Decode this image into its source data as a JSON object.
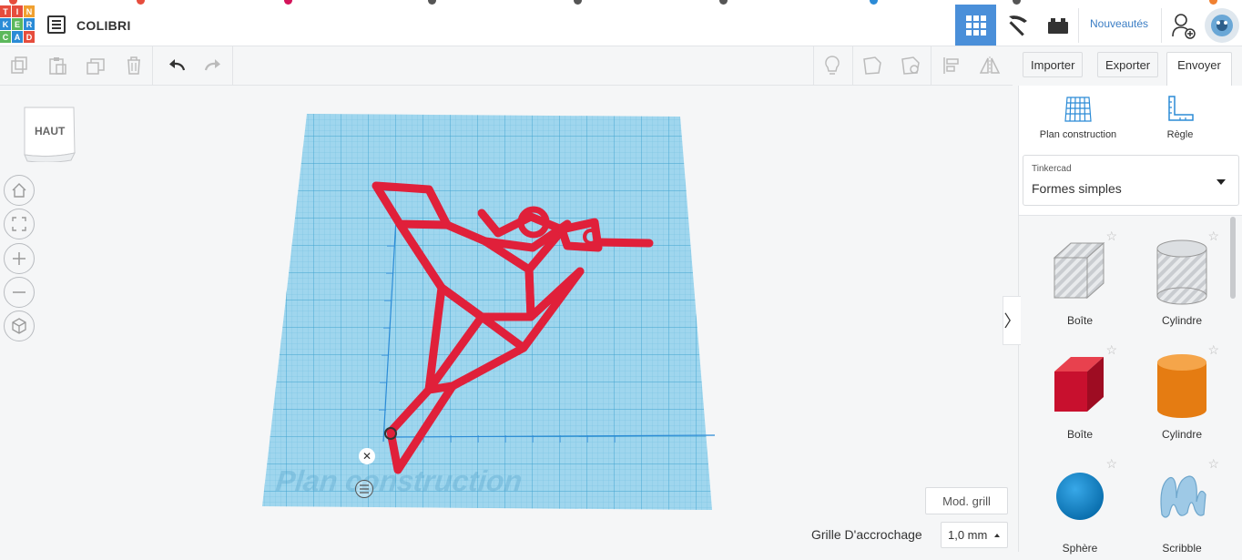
{
  "app": {
    "logo_letters": [
      "T",
      "I",
      "N",
      "K",
      "E",
      "R",
      "C",
      "A",
      "D"
    ],
    "project_title": "COLIBRI",
    "nouveautes": "Nouveautés",
    "colors": {
      "accent": "#4a8fd9",
      "logo_red": "#e64d3d",
      "logo_green": "#5cb85c",
      "logo_blue": "#2b8bd6",
      "logo_orange": "#f0a030",
      "model_red": "#e0203a"
    }
  },
  "toolbar": {
    "left_icons": [
      "copy-icon",
      "paste-icon",
      "duplicate-icon",
      "trash-icon",
      "undo-icon",
      "redo-icon"
    ],
    "right_icons": [
      "lightbulb-icon",
      "note-icon",
      "notes-visibility-icon",
      "align-icon",
      "mirror-icon"
    ],
    "import_label": "Importer",
    "export_label": "Exporter",
    "send_label": "Envoyer vers"
  },
  "viewcube": {
    "face_label": "HAUT"
  },
  "nav": [
    "home-icon",
    "fit-view-icon",
    "zoom-in-icon",
    "zoom-out-icon",
    "perspective-icon"
  ],
  "panel": {
    "tools": [
      {
        "label": "Plan construction",
        "icon": "workplane-icon"
      },
      {
        "label": "Règle",
        "icon": "ruler-icon"
      }
    ],
    "category_small": "Tinkercad",
    "category_selected": "Formes simples",
    "shapes": [
      {
        "label": "Boîte",
        "kind": "box-hole"
      },
      {
        "label": "Cylindre",
        "kind": "cylinder-hole"
      },
      {
        "label": "Boîte",
        "kind": "box-red"
      },
      {
        "label": "Cylindre",
        "kind": "cylinder-orange"
      },
      {
        "label": "Sphère",
        "kind": "sphere-blue"
      },
      {
        "label": "Scribble",
        "kind": "scribble"
      }
    ]
  },
  "workplane": {
    "label": "Plan construction"
  },
  "bottom": {
    "mod_grill": "Mod. grill",
    "snap_label": "Grille D'accrochage",
    "snap_value": "1,0 mm"
  }
}
